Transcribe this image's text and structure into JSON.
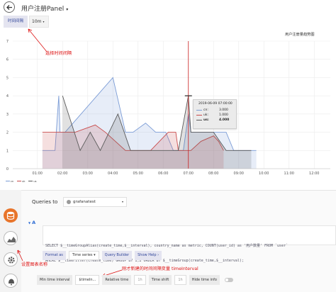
{
  "header": {
    "title": "用户注册Panel",
    "caret": "▾"
  },
  "toolbar": {
    "interval_label": "时间间隔",
    "interval_value": "10m",
    "caret": "▾"
  },
  "chart_data": {
    "type": "area",
    "title": "",
    "legend_title": "用户注册量趋势图",
    "x_ticks": [
      "01:00",
      "02:00",
      "03:00",
      "04:00",
      "05:00",
      "06:00",
      "07:00",
      "08:00",
      "09:00",
      "10:00",
      "11:00",
      "12:00"
    ],
    "y_ticks": [
      "0",
      "1",
      "2",
      "3",
      "4",
      "5",
      "6",
      "7"
    ],
    "ylim": [
      0,
      7
    ],
    "grid": true,
    "series": [
      {
        "name": "cn",
        "color": "#7b9cd6",
        "points": [
          [
            0.7,
            1
          ],
          [
            1.2,
            1
          ],
          [
            1.35,
            4
          ],
          [
            1.4,
            2
          ],
          [
            1.6,
            2
          ],
          [
            3.5,
            5
          ],
          [
            4.0,
            2
          ],
          [
            4.3,
            2
          ],
          [
            4.8,
            2.5
          ],
          [
            5.2,
            2
          ],
          [
            5.6,
            2
          ],
          [
            5.9,
            1
          ],
          [
            6.3,
            1
          ],
          [
            6.5,
            3
          ],
          [
            6.6,
            2
          ],
          [
            7.0,
            2
          ],
          [
            7.5,
            2
          ],
          [
            8.0,
            2
          ],
          [
            8.3,
            1
          ],
          [
            9.0,
            1
          ],
          [
            9.2,
            1
          ]
        ]
      },
      {
        "name": "uk",
        "color": "#c94b4b",
        "points": [
          [
            0.7,
            2
          ],
          [
            2.0,
            2
          ],
          [
            2.8,
            2.4
          ],
          [
            3.2,
            2
          ],
          [
            4.0,
            1
          ],
          [
            5.0,
            1
          ],
          [
            5.7,
            2
          ],
          [
            6.0,
            2
          ],
          [
            6.1,
            1
          ],
          [
            6.5,
            1
          ],
          [
            6.6,
            1
          ],
          [
            7.0,
            1.5
          ],
          [
            7.5,
            1.8
          ],
          [
            7.7,
            1.5
          ],
          [
            7.9,
            1
          ]
        ]
      },
      {
        "name": "us",
        "color": "#5a5a5a",
        "points": [
          [
            1.5,
            4
          ],
          [
            2.2,
            1
          ],
          [
            2.6,
            2
          ],
          [
            3.0,
            1
          ],
          [
            3.7,
            3
          ],
          [
            4.2,
            1
          ],
          [
            5.0,
            1
          ],
          [
            5.6,
            1
          ],
          [
            6.1,
            1
          ],
          [
            6.5,
            4
          ],
          [
            6.6,
            2
          ],
          [
            7.0,
            2
          ],
          [
            7.5,
            2
          ],
          [
            8.0,
            1
          ],
          [
            8.5,
            1
          ],
          [
            9.0,
            1
          ]
        ]
      }
    ],
    "crosshair_x": 6.5
  },
  "tooltip": {
    "time": "2019-06-09 07:00:00",
    "rows": [
      {
        "name": "cn:",
        "value": "3.000",
        "color": "#7b9cd6"
      },
      {
        "name": "uk:",
        "value": "1.000",
        "color": "#c94b4b"
      },
      {
        "name": "us:",
        "value": "4.000",
        "color": "#5a5a5a"
      }
    ]
  },
  "legend": [
    {
      "name": "cn",
      "color": "#7b9cd6"
    },
    {
      "name": "uk",
      "color": "#c94b4b"
    },
    {
      "name": "us",
      "color": "#5a5a5a"
    }
  ],
  "annotations": {
    "select_interval": "选择时间间隔",
    "set_chart_name": "设置图表名称",
    "ref_interval": "刚才新建的时间间隔变量 timeInterval"
  },
  "editor": {
    "queries_to": "Queries to",
    "datasource": "grafanatest",
    "row_label": "A",
    "sql_line1": "SELECT $__timeGroupAlias(create_time,$__interval), country_name as metric, COUNT(user_id) as '用户数量' FROM `user`",
    "sql_line2": "WHERE $__timeFilter(create_time) GROUP BY 1,2 ORDER BY $__timeGroup(create_time,$__interval);",
    "format_as_label": "Format as",
    "format_as_value": "Time series",
    "format_caret": "▾",
    "query_builder": "Query Builder",
    "show_help": "Show Help ›",
    "min_interval_label": "Min time interval",
    "min_interval_value": "$timeIn...",
    "relative_time_label": "Relative time",
    "relative_time_placeholder": "1h",
    "time_shift_label": "Time shift",
    "time_shift_placeholder": "1h",
    "hide_time_info_label": "Hide time info"
  },
  "colors": {
    "accent": "#33489b",
    "annotation": "#dd1111",
    "crosshair": "#cc2222"
  }
}
